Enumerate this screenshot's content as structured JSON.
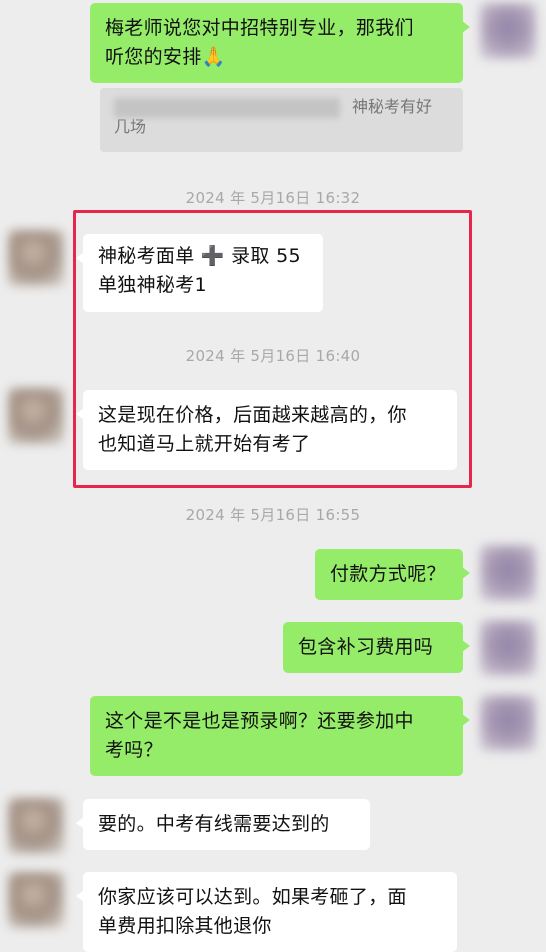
{
  "messages": [
    {
      "side": "right",
      "text_line1": "梅老师说您对中招特别专业，那我们",
      "text_line2": "听您的安排🙏"
    },
    {
      "quote_tail": "神秘考有好",
      "quote_line2": "几场"
    },
    {
      "timestamp": "2024 年 5月16日 16:32"
    },
    {
      "side": "left",
      "text_line1": "神秘考面单 ➕ 录取 55",
      "text_line2": "单独神秘考1"
    },
    {
      "timestamp": "2024 年 5月16日 16:40"
    },
    {
      "side": "left",
      "text_line1": "这是现在价格，后面越来越高的，你",
      "text_line2": "也知道马上就开始有考了"
    },
    {
      "timestamp": "2024 年 5月16日 16:55"
    },
    {
      "side": "right",
      "text_line1": "付款方式呢？"
    },
    {
      "side": "right",
      "text_line1": "包含补习费用吗"
    },
    {
      "side": "right",
      "text_line1": "这个是不是也是预录啊？还要参加中",
      "text_line2": "考吗？"
    },
    {
      "side": "left",
      "text_line1": "要的。中考有线需要达到的"
    },
    {
      "side": "left",
      "text_line1": "你家应该可以达到。如果考砸了，面",
      "text_line2": "单费用扣除其他退你"
    }
  ],
  "colors": {
    "accent": "#95ec69",
    "highlight": "#e8264b",
    "background": "#ededed"
  }
}
